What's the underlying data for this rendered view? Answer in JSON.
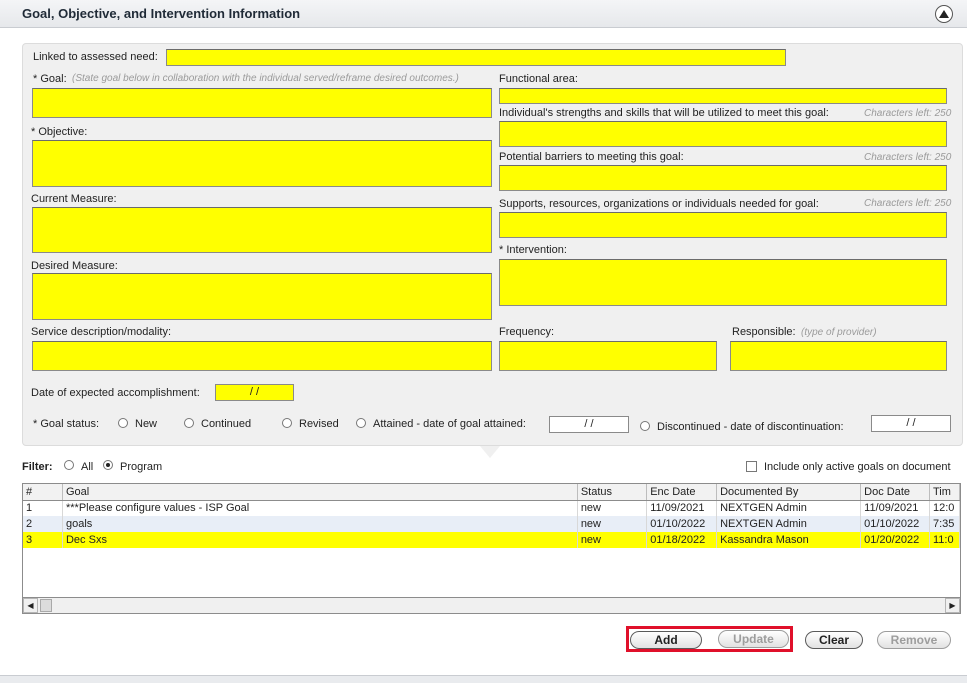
{
  "section": {
    "title": "Goal, Objective, and Intervention Information",
    "collapse_icon": "chevron-up-circle-icon"
  },
  "form": {
    "linked_need_label": "Linked to assessed need:",
    "goal_label": "* Goal:",
    "goal_hint": "(State goal below in collaboration with the individual served/reframe desired outcomes.)",
    "objective_label": "* Objective:",
    "current_measure_label": "Current Measure:",
    "desired_measure_label": "Desired Measure:",
    "service_label": "Service description/modality:",
    "functional_area_label": "Functional area:",
    "strengths_label": "Individual's strengths and skills that will be utilized to meet this goal:",
    "strengths_chars": "Characters left: 250",
    "barriers_label": "Potential barriers to meeting this goal:",
    "barriers_chars": "Characters left: 250",
    "supports_label": "Supports, resources, organizations or individuals needed for goal:",
    "supports_chars": "Characters left: 250",
    "intervention_label": "* Intervention:",
    "frequency_label": "Frequency:",
    "responsible_label": "Responsible:",
    "responsible_hint": "(type of provider)",
    "expected_date_label": "Date of expected accomplishment:",
    "expected_date_value": "/  /",
    "status_label": "* Goal status:",
    "status_new": "New",
    "status_continued": "Continued",
    "status_revised": "Revised",
    "status_attained": "Attained - date of goal attained:",
    "attained_date_value": "/  /",
    "status_discontinued": "Discontinued - date of discontinuation:",
    "discontinued_date_value": "/  /"
  },
  "filter": {
    "label": "Filter:",
    "all": "All",
    "program": "Program",
    "selected": "Program",
    "active_only_label": "Include only active goals on document"
  },
  "grid": {
    "columns": [
      "#",
      "Goal",
      "Status",
      "Enc Date",
      "Documented By",
      "Doc Date",
      "Tim"
    ],
    "rows": [
      [
        "1",
        "***Please configure values - ISP Goal",
        "new",
        "11/09/2021",
        "NEXTGEN Admin",
        "11/09/2021",
        "12:0"
      ],
      [
        "2",
        "goals",
        "new",
        "01/10/2022",
        "NEXTGEN Admin",
        "01/10/2022",
        "7:35"
      ],
      [
        "3",
        "Dec Sxs",
        "new",
        "01/18/2022",
        "Kassandra Mason",
        "01/20/2022",
        "11:0"
      ]
    ],
    "selected_row": 3
  },
  "buttons": {
    "add": "Add",
    "update": "Update",
    "clear": "Clear",
    "remove": "Remove"
  },
  "colors": {
    "field_yellow": "#ffff00",
    "highlight_red": "#e0102a",
    "panel_gray": "#f0f0f0"
  }
}
